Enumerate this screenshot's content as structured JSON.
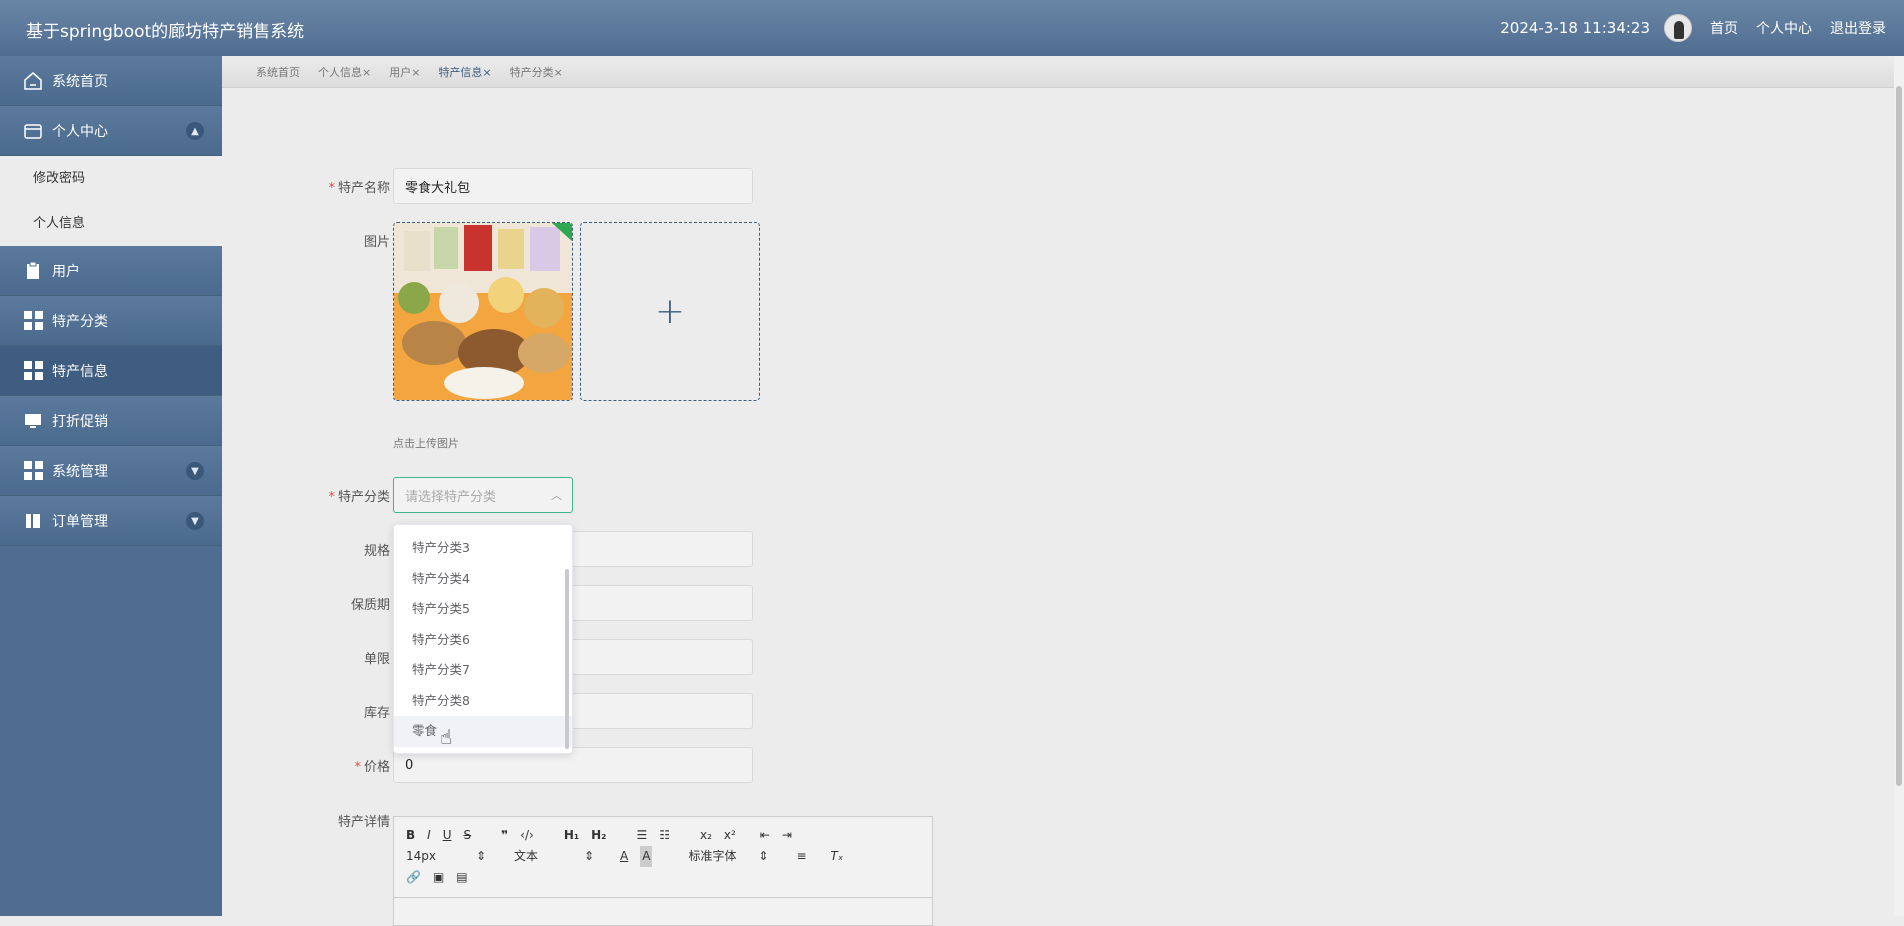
{
  "app": {
    "title": "基于springboot的廊坊特产销售系统"
  },
  "header": {
    "datetime": "2024-3-18 11:34:23",
    "links": {
      "home": "首页",
      "profile": "个人中心",
      "logout": "退出登录"
    }
  },
  "sidebar": {
    "items": {
      "home": "系统首页",
      "personal": "个人中心",
      "sub_password": "修改密码",
      "sub_info": "个人信息",
      "user": "用户",
      "category": "特产分类",
      "product": "特产信息",
      "discount": "打折促销",
      "system": "系统管理",
      "order": "订单管理"
    }
  },
  "tabs": [
    "系统首页",
    "个人信息×",
    "用户×",
    "特产信息×",
    "特产分类×"
  ],
  "form": {
    "name_label": "特产名称",
    "name_value": "零食大礼包",
    "image_label": "图片",
    "upload_tip": "点击上传图片",
    "category_label": "特产分类",
    "category_placeholder": "请选择特产分类",
    "spec_label": "规格",
    "shelf_label": "保质期",
    "limit_label": "单限",
    "stock_label": "库存",
    "price_label": "价格",
    "price_value": "0",
    "detail_label": "特产详情"
  },
  "dropdown": {
    "options": [
      "特产分类3",
      "特产分类4",
      "特产分类5",
      "特产分类6",
      "特产分类7",
      "特产分类8",
      "零食"
    ]
  },
  "editor": {
    "font_size": "14px",
    "text_type": "文本",
    "font_family": "标准字体"
  }
}
